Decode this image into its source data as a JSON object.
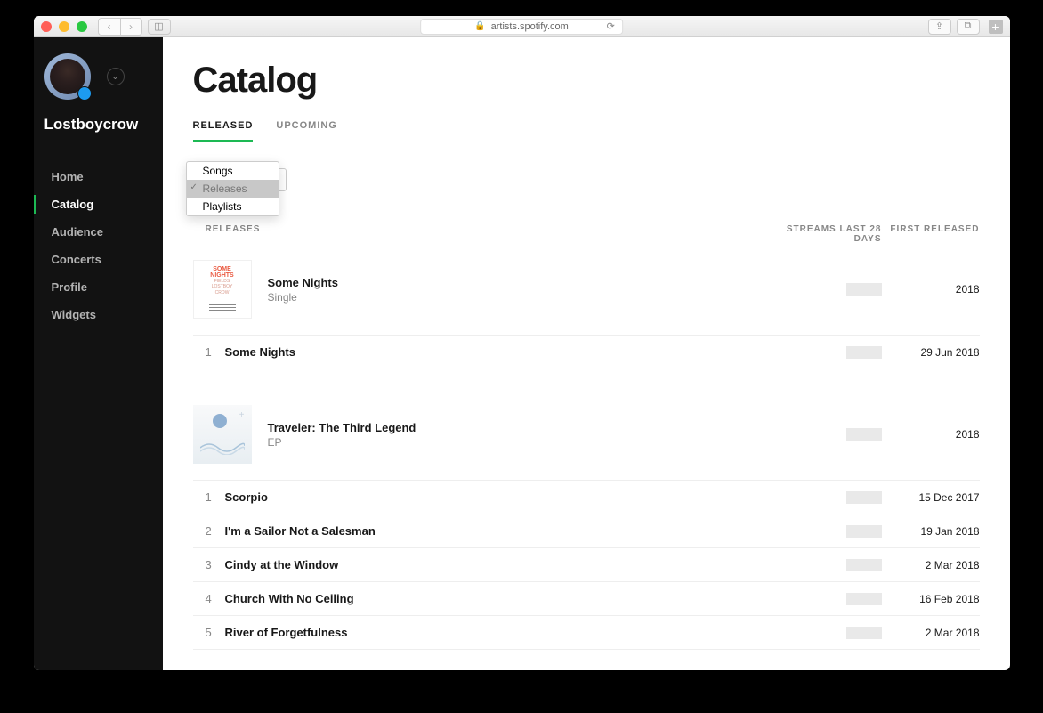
{
  "browser": {
    "url": "artists.spotify.com"
  },
  "sidebar": {
    "artist": "Lostboycrow",
    "nav": [
      "Home",
      "Catalog",
      "Audience",
      "Concerts",
      "Profile",
      "Widgets"
    ],
    "activeIndex": 1
  },
  "page": {
    "title": "Catalog"
  },
  "tabs": {
    "items": [
      "RELEASED",
      "UPCOMING"
    ],
    "activeIndex": 0
  },
  "filter": {
    "options": [
      "Songs",
      "Releases",
      "Playlists"
    ],
    "selectedIndex": 1
  },
  "columns": {
    "releases": "RELEASES",
    "streams": "STREAMS LAST 28 DAYS",
    "first": "FIRST RELEASED"
  },
  "releases": [
    {
      "title": "Some Nights",
      "type": "Single",
      "year": "2018",
      "tracks": [
        {
          "n": "1",
          "title": "Some Nights",
          "date": "29 Jun 2018"
        }
      ]
    },
    {
      "title": "Traveler: The Third Legend",
      "type": "EP",
      "year": "2018",
      "tracks": [
        {
          "n": "1",
          "title": "Scorpio",
          "date": "15 Dec 2017"
        },
        {
          "n": "2",
          "title": "I'm a Sailor Not a Salesman",
          "date": "19 Jan 2018"
        },
        {
          "n": "3",
          "title": "Cindy at the Window",
          "date": "2 Mar 2018"
        },
        {
          "n": "4",
          "title": "Church With No Ceiling",
          "date": "16 Feb 2018"
        },
        {
          "n": "5",
          "title": "River of Forgetfulness",
          "date": "2 Mar 2018"
        }
      ]
    }
  ]
}
